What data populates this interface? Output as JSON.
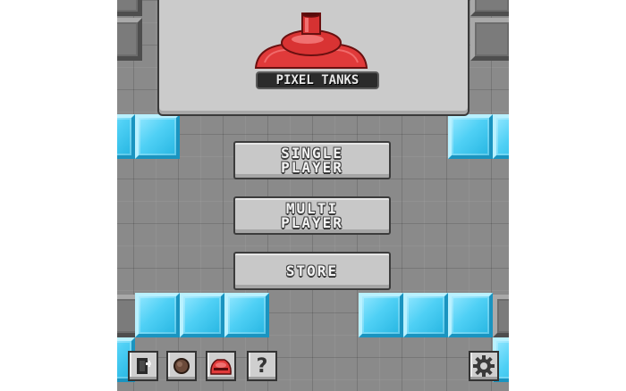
{
  "game": {
    "title": "PIXEL TANKS",
    "logo": "red-tank-turret-logo"
  },
  "menu": {
    "single_player": [
      "SINGLE",
      "PLAYER"
    ],
    "multi_player": [
      "MULTI",
      "PLAYER"
    ],
    "store": "STORE"
  },
  "toolbar": {
    "items": [
      {
        "icon": "door-exit-icon"
      },
      {
        "icon": "coin-icon"
      },
      {
        "icon": "red-character-icon"
      },
      {
        "icon": "help-question-icon",
        "glyph": "?"
      },
      {
        "icon": "settings-gear-icon"
      }
    ]
  },
  "colors": {
    "background_floor": "#8a8a8a",
    "ice_block": "#4fd0f5",
    "tank_red": "#e03a3a",
    "button_face": "#c8c8c8"
  }
}
